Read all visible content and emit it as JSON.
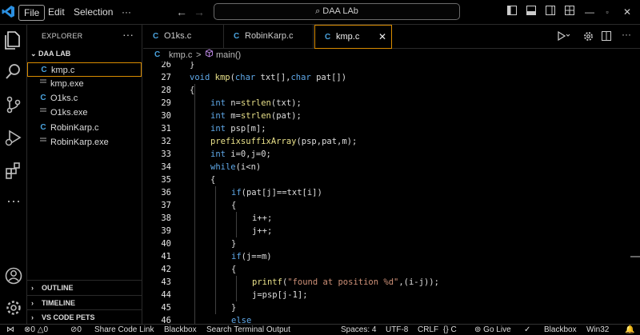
{
  "titlebar": {
    "menus": [
      "File",
      "Edit",
      "Selection",
      "···"
    ],
    "search_text": "DAA LAb"
  },
  "explorer": {
    "title": "EXPLORER",
    "more": "···",
    "folder": "DAA LAB",
    "files": [
      {
        "icon": "C",
        "name": "kmp.c",
        "selected": true
      },
      {
        "icon": "",
        "name": "kmp.exe"
      },
      {
        "icon": "C",
        "name": "O1ks.c"
      },
      {
        "icon": "",
        "name": "O1ks.exe"
      },
      {
        "icon": "C",
        "name": "RobinKarp.c"
      },
      {
        "icon": "",
        "name": "RobinKarp.exe"
      }
    ],
    "sections": [
      "OUTLINE",
      "TIMELINE",
      "VS CODE PETS"
    ]
  },
  "tabs": [
    {
      "icon": "C",
      "label": "O1ks.c"
    },
    {
      "icon": "C",
      "label": "RobinKarp.c"
    },
    {
      "icon": "C",
      "label": "kmp.c",
      "active": true,
      "close": "✕"
    }
  ],
  "breadcrumb": {
    "file_icon": "C",
    "file": "kmp.c",
    "sep": ">",
    "symbol": "main()"
  },
  "code_lines": [
    {
      "n": "26",
      "text": "}"
    },
    {
      "n": "27",
      "text": "void kmp(char txt[],char pat[])"
    },
    {
      "n": "28",
      "text": "{"
    },
    {
      "n": "29",
      "text": "int n=strlen(txt);"
    },
    {
      "n": "30",
      "text": "int m=strlen(pat);"
    },
    {
      "n": "31",
      "text": "int psp[m];"
    },
    {
      "n": "32",
      "text": "prefixsuffixArray(psp,pat,m);"
    },
    {
      "n": "33",
      "text": "int i=0,j=0;"
    },
    {
      "n": "34",
      "text": "while(i<n)"
    },
    {
      "n": "35",
      "text": "{"
    },
    {
      "n": "36",
      "text": "if(pat[j]==txt[i])"
    },
    {
      "n": "37",
      "text": "{"
    },
    {
      "n": "38",
      "text": "i++;"
    },
    {
      "n": "39",
      "text": "j++;"
    },
    {
      "n": "40",
      "text": "}"
    },
    {
      "n": "41",
      "text": "if(j==m)"
    },
    {
      "n": "42",
      "text": "{"
    },
    {
      "n": "43",
      "text": "printf(\"found at position %d\",(i-j));"
    },
    {
      "n": "44",
      "text": "j=psp[j-1];"
    },
    {
      "n": "45",
      "text": "}"
    },
    {
      "n": "46",
      "text": "else"
    }
  ],
  "status": {
    "errors": "0",
    "warnings": "0",
    "ports": "0",
    "share": "Share Code Link",
    "blackbox": "Blackbox",
    "search_terminal": "Search Terminal Output",
    "spaces": "Spaces: 4",
    "encoding": "UTF-8",
    "eol": "CRLF",
    "language": "C",
    "golive": "Go Live",
    "blackbox2": "Blackbox",
    "platform": "Win32"
  },
  "colors": {
    "accent": "#d98c00",
    "c_icon": "#4aa3df",
    "keyword": "#5fa8e8",
    "function": "#e8e089",
    "string": "#ce9178"
  }
}
